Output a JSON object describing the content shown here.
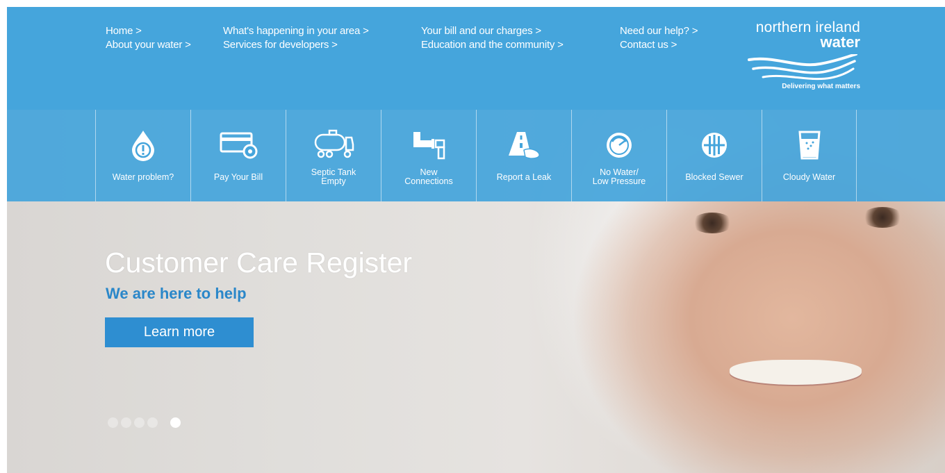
{
  "nav": {
    "col1": [
      "Home >",
      "About your water >"
    ],
    "col2": [
      "What's happening in your area >",
      "Services for developers >"
    ],
    "col3": [
      "Your bill and our charges >",
      "Education and the community >"
    ],
    "col4": [
      "Need our help? >",
      "Contact us >"
    ]
  },
  "logo": {
    "line1": "northern ireland",
    "line2": "water",
    "tagline": "Delivering what matters"
  },
  "quick_links": [
    {
      "label": "Water problem?",
      "icon": "water-drop-alert-icon"
    },
    {
      "label": "Pay Your Bill",
      "icon": "credit-card-icon"
    },
    {
      "label": "Septic Tank\nEmpty",
      "icon": "tanker-truck-icon"
    },
    {
      "label": "New\nConnections",
      "icon": "pipe-connection-icon"
    },
    {
      "label": "Report a Leak",
      "icon": "road-leak-icon"
    },
    {
      "label": "No Water/\nLow Pressure",
      "icon": "pressure-gauge-icon"
    },
    {
      "label": "Blocked Sewer",
      "icon": "sewer-grate-icon"
    },
    {
      "label": "Cloudy Water",
      "icon": "cloudy-glass-icon"
    }
  ],
  "hero": {
    "title": "Customer Care Register",
    "subtitle": "We are here to help",
    "cta": "Learn more",
    "slides": 5,
    "active_slide": 5
  },
  "colors": {
    "header_blue": "#45a5dc",
    "accent_blue": "#2e8ed1",
    "subtitle_blue": "#2a87c9"
  }
}
